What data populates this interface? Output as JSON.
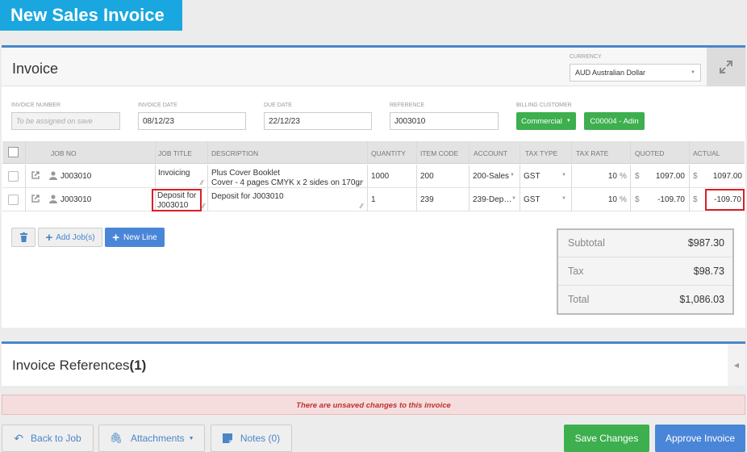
{
  "page": {
    "title": "New Sales Invoice"
  },
  "invoice": {
    "heading": "Invoice",
    "currency_label": "CURRENCY",
    "currency_value": "AUD Australian Dollar",
    "fields": {
      "invoice_number_label": "INVOICE NUMBER",
      "invoice_number_placeholder": "To be assigned on save",
      "invoice_date_label": "INVOICE DATE",
      "invoice_date_value": "08/12/23",
      "due_date_label": "DUE DATE",
      "due_date_value": "22/12/23",
      "reference_label": "REFERENCE",
      "reference_value": "J003010",
      "billing_customer_label": "BILLING CUSTOMER",
      "billing_type": "Commercial",
      "customer_button": "C00004 - Adin"
    }
  },
  "table": {
    "headers": {
      "job_no": "JOB NO",
      "job_title": "JOB TITLE",
      "description": "DESCRIPTION",
      "quantity": "QUANTITY",
      "item_code": "ITEM CODE",
      "account": "ACCOUNT",
      "tax_type": "TAX TYPE",
      "tax_rate": "TAX RATE",
      "quoted": "QUOTED",
      "actual": "ACTUAL"
    },
    "rows": [
      {
        "job_no": "J003010",
        "job_title": "Invoicing",
        "description_line1": "Plus Cover Booklet",
        "description_line2": "Cover - 4 pages CMYK x 2 sides on 170gsm",
        "quantity": "1000",
        "item_code": "200",
        "account": "200-Sales",
        "tax_type": "GST",
        "tax_rate": "10",
        "quoted_currency": "$",
        "quoted": "1097.00",
        "actual_currency": "$",
        "actual": "1097.00"
      },
      {
        "job_no": "J003010",
        "job_title_line1": "Deposit for",
        "job_title_line2": "J003010",
        "description_line1": "Deposit for J003010",
        "quantity": "1",
        "item_code": "239",
        "account": "239-Dep…",
        "tax_type": "GST",
        "tax_rate": "10",
        "quoted_currency": "$",
        "quoted": "-109.70",
        "actual_currency": "$",
        "actual": "-109.70"
      }
    ],
    "percent_sign": "%"
  },
  "actions": {
    "add_jobs": "Add Job(s)",
    "new_line": "New Line"
  },
  "totals": {
    "subtotal_label": "Subtotal",
    "subtotal_value": "$987.30",
    "tax_label": "Tax",
    "tax_value": "$98.73",
    "total_label": "Total",
    "total_value": "$1,086.03"
  },
  "references": {
    "title": "Invoice References",
    "count": "(1)"
  },
  "status": {
    "unsaved_message": "There are unsaved changes to this invoice"
  },
  "footer": {
    "back_to_job": "Back to Job",
    "attachments": "Attachments",
    "notes": "Notes (0)",
    "save_changes": "Save Changes",
    "approve_invoice": "Approve Invoice"
  },
  "colors": {
    "banner": "#1aa7e0",
    "accent_blue": "#4a86c8",
    "green": "#3daf4e",
    "highlight_red": "#d81f26"
  }
}
